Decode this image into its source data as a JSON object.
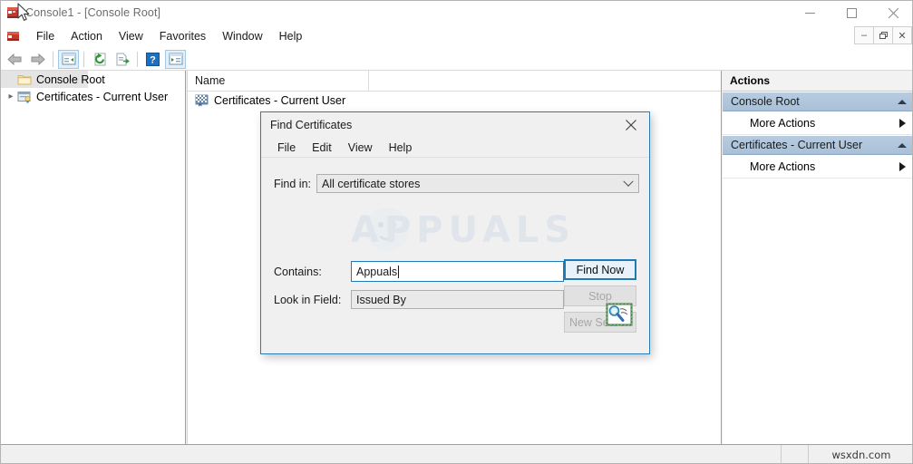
{
  "window": {
    "title": "Console1 - [Console Root]",
    "app_icon": "mmc-console-icon",
    "controls": [
      {
        "name": "minimize-button",
        "glyph": "—"
      },
      {
        "name": "maximize-button",
        "glyph": "□"
      },
      {
        "name": "close-button",
        "glyph": "✕"
      }
    ],
    "mdi_controls": [
      {
        "name": "mdi-minimize-button",
        "glyph": "–"
      },
      {
        "name": "mdi-restore-button",
        "glyph": "❐"
      },
      {
        "name": "mdi-close-button",
        "glyph": "✕"
      }
    ]
  },
  "menubar": {
    "items": [
      {
        "label": "File"
      },
      {
        "label": "Action"
      },
      {
        "label": "View"
      },
      {
        "label": "Favorites"
      },
      {
        "label": "Window"
      },
      {
        "label": "Help"
      }
    ]
  },
  "toolbar": {
    "buttons": [
      {
        "name": "back-arrow-icon",
        "framed": false
      },
      {
        "name": "forward-arrow-icon",
        "framed": false
      },
      {
        "name": "show-hide-tree-icon",
        "framed": true
      },
      {
        "name": "refresh-icon",
        "framed": false
      },
      {
        "name": "export-list-icon",
        "framed": false
      },
      {
        "name": "help-icon",
        "framed": false
      },
      {
        "name": "show-hide-actions-icon",
        "framed": true
      }
    ]
  },
  "tree": {
    "items": [
      {
        "label": "Console Root",
        "icon": "folder-icon",
        "selected": true,
        "expandable": false,
        "indent": 0
      },
      {
        "label": "Certificates - Current User",
        "icon": "certificates-snapin-icon",
        "selected": false,
        "expandable": true,
        "indent": 1
      }
    ]
  },
  "list": {
    "columns": [
      {
        "label": "Name"
      }
    ],
    "rows": [
      {
        "name": "Certificates - Current User",
        "icon": "certificate-icon"
      }
    ]
  },
  "actions": {
    "title": "Actions",
    "groups": [
      {
        "label": "Console Root",
        "collapse_icon": "chevron-up-icon",
        "items": [
          {
            "label": "More Actions",
            "submenu_icon": "chevron-right-icon"
          }
        ]
      },
      {
        "label": "Certificates - Current User",
        "collapse_icon": "chevron-up-icon",
        "items": [
          {
            "label": "More Actions",
            "submenu_icon": "chevron-right-icon"
          }
        ]
      }
    ]
  },
  "statusbar": {
    "watermark": "wsxdn.com"
  },
  "dialog": {
    "title": "Find Certificates",
    "close_icon": "close-icon",
    "menu": [
      {
        "label": "File"
      },
      {
        "label": "Edit"
      },
      {
        "label": "View"
      },
      {
        "label": "Help"
      }
    ],
    "fields": {
      "find_in": {
        "label": "Find in:",
        "value": "All certificate stores",
        "chevron_icon": "chevron-down-icon"
      },
      "contains": {
        "label": "Contains:",
        "value": "Appuals",
        "placeholder": ""
      },
      "look_in_field": {
        "label": "Look in Field:",
        "value": "Issued By",
        "chevron_icon": "chevron-down-icon"
      }
    },
    "buttons": [
      {
        "label": "Find Now",
        "state": "primary"
      },
      {
        "label": "Stop",
        "state": "disabled"
      },
      {
        "label": "New Search",
        "state": "disabled"
      }
    ],
    "result_icon": "find-certificates-icon"
  },
  "overlay_watermark": {
    "text": "APPUALS"
  },
  "colors": {
    "accent_blue": "#1f7ab8",
    "actions_group_blue": "#b8cce0",
    "selection_gray": "#e4e4e4",
    "window_chrome": "#f0f0f0"
  }
}
